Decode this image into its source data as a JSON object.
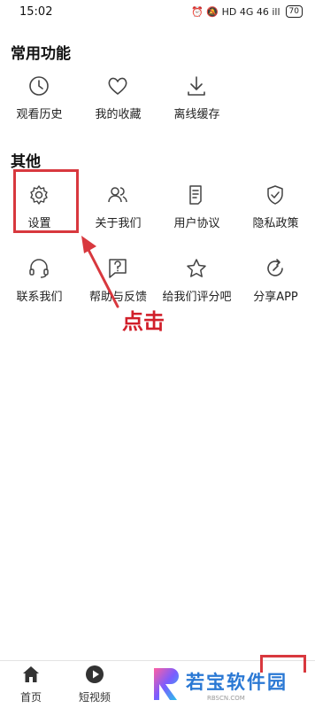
{
  "status": {
    "time": "15:02",
    "icons": "⏰ 🔕 HD 4G 46 ill",
    "battery": "70"
  },
  "sections": [
    {
      "title": "常用功能",
      "items": [
        {
          "label": "观看历史",
          "icon": "clock-icon"
        },
        {
          "label": "我的收藏",
          "icon": "heart-icon"
        },
        {
          "label": "离线缓存",
          "icon": "download-icon"
        }
      ]
    },
    {
      "title": "其他",
      "items": [
        {
          "label": "设置",
          "icon": "gear-icon"
        },
        {
          "label": "关于我们",
          "icon": "users-icon"
        },
        {
          "label": "用户协议",
          "icon": "document-icon"
        },
        {
          "label": "隐私政策",
          "icon": "shield-icon"
        },
        {
          "label": "联系我们",
          "icon": "headset-icon"
        },
        {
          "label": "帮助与反馈",
          "icon": "feedback-icon"
        },
        {
          "label": "给我们评分吧",
          "icon": "star-icon"
        },
        {
          "label": "分享APP",
          "icon": "share-icon"
        }
      ]
    }
  ],
  "annotation": {
    "text": "点击",
    "color": "#d11f2a"
  },
  "bottom_nav": [
    {
      "label": "首页",
      "icon": "home-icon"
    },
    {
      "label": "短视频",
      "icon": "play-icon"
    }
  ],
  "watermark": {
    "text": "若宝软件园",
    "sub": "RBSCN.COM",
    "logo": "R-logo"
  }
}
